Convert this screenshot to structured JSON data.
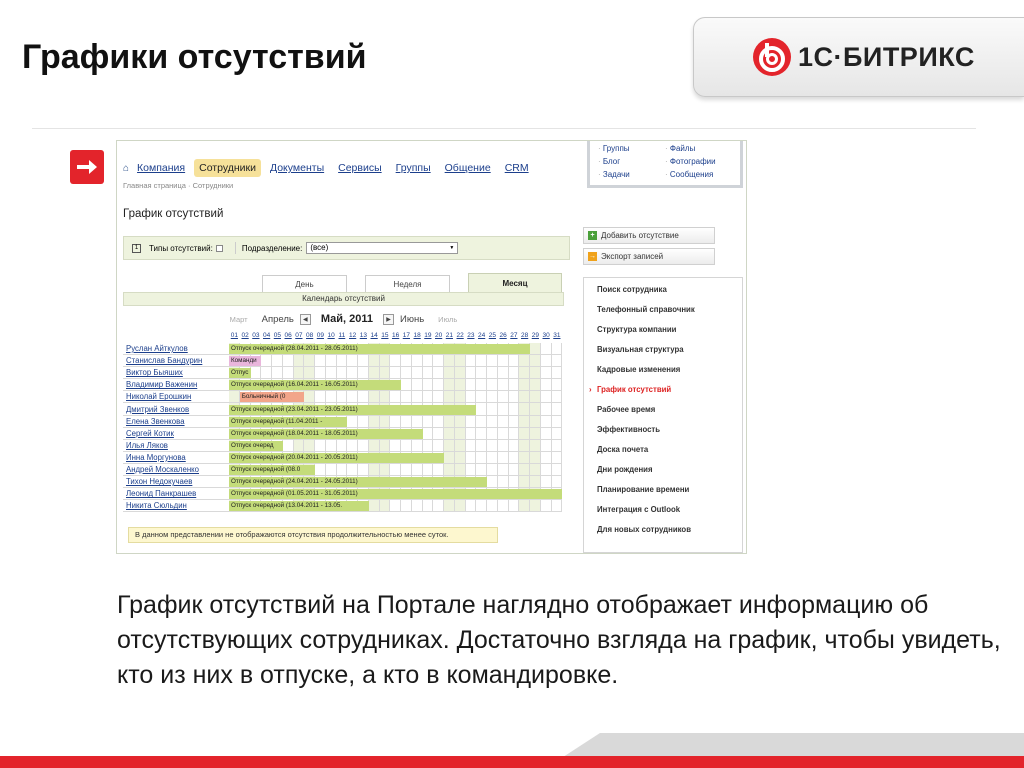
{
  "slide": {
    "title": "Графики отсутствий",
    "logo_text": "1С·БИТРИКС",
    "description": "График отсутствий на Портале наглядно отображает информацию об отсутствующих сотрудниках. Достаточно взгляда на график, чтобы увидеть, кто из них в отпуске, а кто в командировке.",
    "accent_color": "#e3242b"
  },
  "portal": {
    "nav": [
      {
        "label": "Компания",
        "active": false
      },
      {
        "label": "Сотрудники",
        "active": true
      },
      {
        "label": "Документы",
        "active": false
      },
      {
        "label": "Сервисы",
        "active": false
      },
      {
        "label": "Группы",
        "active": false
      },
      {
        "label": "Общение",
        "active": false
      },
      {
        "label": "CRM",
        "active": false
      }
    ],
    "breadcrumbs": "Главная страница  ·  Сотрудники",
    "dropdown": [
      "Группы",
      "Файлы",
      "Блог",
      "Фотографии",
      "Задачи",
      "Сообщения"
    ],
    "page_title": "График отсутствий",
    "filters": {
      "types_label": "Типы отсутствий:",
      "department_label": "Подразделение:",
      "department_value": "(все)"
    },
    "tabs": [
      {
        "label": "День",
        "active": false
      },
      {
        "label": "Неделя",
        "active": false
      },
      {
        "label": "Месяц",
        "active": true
      }
    ],
    "calendar_title": "Календарь отсутствий",
    "month_nav": {
      "far_prev": "Март",
      "prev": "Апрель",
      "current": "Май, 2011",
      "next": "Июнь",
      "far_next": "Июль"
    },
    "days": [
      "01",
      "02",
      "03",
      "04",
      "05",
      "06",
      "07",
      "08",
      "09",
      "10",
      "11",
      "12",
      "13",
      "14",
      "15",
      "16",
      "17",
      "18",
      "19",
      "20",
      "21",
      "22",
      "23",
      "24",
      "25",
      "26",
      "27",
      "28",
      "29",
      "30",
      "31"
    ],
    "weekend_days": [
      1,
      7,
      8,
      14,
      15,
      21,
      22,
      28,
      29
    ],
    "employees": [
      {
        "name": "Руслан Айткулов",
        "label": "Отпуск очередной (28.04.2011 - 28.05.2011)",
        "type": "vac",
        "start": 1,
        "end": 28
      },
      {
        "name": "Станислав Бандурин",
        "label": "Команди",
        "type": "trip",
        "start": 1,
        "end": 3
      },
      {
        "name": "Виктор Быяших",
        "label": "Отпус",
        "type": "vac",
        "start": 1,
        "end": 2
      },
      {
        "name": "Владимир Важенин",
        "label": "Отпуск очередной (16.04.2011 - 16.05.2011)",
        "type": "vac",
        "start": 1,
        "end": 16
      },
      {
        "name": "Николай Ерошкин",
        "label": "Больничный (0",
        "type": "sick",
        "start": 2,
        "end": 7
      },
      {
        "name": "Дмитрий Звенков",
        "label": "Отпуск очередной (23.04.2011 - 23.05.2011)",
        "type": "vac",
        "start": 1,
        "end": 23
      },
      {
        "name": "Елена Звенкова",
        "label": "Отпуск очередной (11.04.2011 -",
        "type": "vac",
        "start": 1,
        "end": 11
      },
      {
        "name": "Сергей Котик",
        "label": "Отпуск очередной (18.04.2011 - 18.05.2011)",
        "type": "vac",
        "start": 1,
        "end": 18
      },
      {
        "name": "Илья Ляков",
        "label": "Отпуск очеред",
        "type": "vac",
        "start": 1,
        "end": 5
      },
      {
        "name": "Инна Моргунова",
        "label": "Отпуск очередной (20.04.2011 - 20.05.2011)",
        "type": "vac",
        "start": 1,
        "end": 20
      },
      {
        "name": "Андрей Москаленко",
        "label": "Отпуск очередной (08.0",
        "type": "vac",
        "start": 1,
        "end": 8
      },
      {
        "name": "Тихон Недокучаев",
        "label": "Отпуск очередной (24.04.2011 - 24.05.2011)",
        "type": "vac",
        "start": 1,
        "end": 24
      },
      {
        "name": "Леонид Панкрашев",
        "label": "Отпуск очередной (01.05.2011 - 31.05.2011)",
        "type": "vac",
        "start": 1,
        "end": 31
      },
      {
        "name": "Никита Сюльдин",
        "label": "Отпуск очередной (13.04.2011 - 13.05.",
        "type": "vac",
        "start": 1,
        "end": 13
      }
    ],
    "note": "В данном представлении не отображаются отсутствия продолжительностью менее суток.",
    "buttons": {
      "add_absence": "Добавить отсутствие",
      "export": "Экспорт записей"
    },
    "side_menu": [
      {
        "label": "Поиск сотрудника",
        "active": false
      },
      {
        "label": "Телефонный справочник",
        "active": false
      },
      {
        "label": "Структура компании",
        "active": false
      },
      {
        "label": "Визуальная структура",
        "active": false
      },
      {
        "label": "Кадровые изменения",
        "active": false
      },
      {
        "label": "График отсутствий",
        "active": true
      },
      {
        "label": "Рабочее время",
        "active": false
      },
      {
        "label": "Эффективность",
        "active": false
      },
      {
        "label": "Доска почета",
        "active": false
      },
      {
        "label": "Дни рождения",
        "active": false
      },
      {
        "label": "Планирование времени",
        "active": false
      },
      {
        "label": "Интеграция с Outlook",
        "active": false
      },
      {
        "label": "Для новых сотрудников",
        "active": false
      }
    ],
    "colors": {
      "vacation": "#c4dc7a",
      "business_trip": "#e9b6dc",
      "sick_leave": "#f2a58a",
      "weekend": "#eef3de"
    }
  }
}
